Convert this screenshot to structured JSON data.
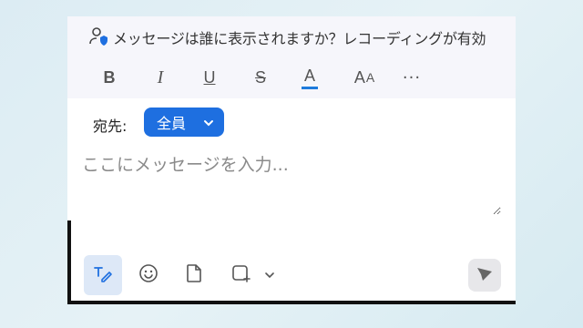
{
  "header": {
    "who_can_see_text": "メッセージは誰に表示されますか？レコーディングが有効"
  },
  "toolbar": {
    "bold_label": "B",
    "italic_label": "I",
    "underline_label": "U",
    "strike_label": "S",
    "color_label": "A",
    "size_label_big": "A",
    "size_label_small": "A",
    "more_label": "···"
  },
  "recipient": {
    "label": "宛先:",
    "selected": "全員"
  },
  "message": {
    "placeholder": "ここにメッセージを入力..."
  },
  "colors": {
    "accent": "#1e6fe0",
    "toolbar_bg": "#f6f6fb",
    "format_active_bg": "#dde8f7"
  },
  "icons": [
    "person-lock-icon",
    "chevron-down-icon",
    "format-icon",
    "emoji-icon",
    "file-icon",
    "screenshot-icon",
    "chevron-down-icon",
    "send-icon"
  ]
}
